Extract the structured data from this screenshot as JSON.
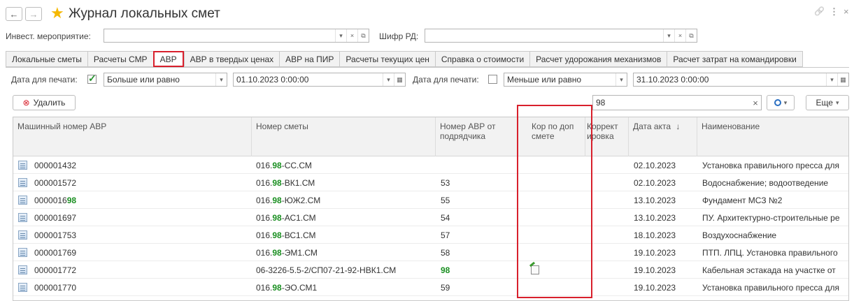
{
  "window": {
    "title": "Журнал локальных смет",
    "back_glyph": "←",
    "forward_glyph": "→",
    "star_glyph": "★",
    "link_glyph": "🔗",
    "more_glyph": "⋮",
    "close_glyph": "×"
  },
  "filters": {
    "invest_label": "Инвест. мероприятие:",
    "invest_value": "",
    "rd_label": "Шифр РД:",
    "rd_value": "",
    "dropdown_glyph": "▾",
    "clear_glyph": "×",
    "open_glyph": "⧉"
  },
  "tabs": [
    {
      "label": "Локальные сметы",
      "active": false
    },
    {
      "label": "Расчеты СМР",
      "active": false
    },
    {
      "label": "АВР",
      "active": true
    },
    {
      "label": "АВР в твердых ценах",
      "active": false
    },
    {
      "label": "АВР на ПИР",
      "active": false
    },
    {
      "label": "Расчеты текущих цен",
      "active": false
    },
    {
      "label": "Справка о стоимости",
      "active": false
    },
    {
      "label": "Расчет удорожания механизмов",
      "active": false
    },
    {
      "label": "Расчет затрат на командировки",
      "active": false
    }
  ],
  "date_filter": {
    "from_label": "Дата для печати:",
    "from_checked": true,
    "from_condition": "Больше или равно",
    "from_date": "01.10.2023  0:00:00",
    "to_label": "Дата для печати:",
    "to_checked": false,
    "to_condition": "Меньше или равно",
    "to_date": "31.10.2023  0:00:00",
    "calendar_glyph": "▦"
  },
  "toolbar": {
    "delete_icon": "⊗",
    "delete_label": "Удалить",
    "search_value": "98",
    "search_clear": "×",
    "search_icon": "🔍",
    "more_label": "Еще"
  },
  "table": {
    "columns": {
      "machine_number": "Машинный номер АВР",
      "estimate_number": "Номер сметы",
      "contractor_number": "Номер АВР от подрядчика",
      "kor_dop": "Кор по доп смете",
      "correction": "Коррект ировка",
      "act_date": "Дата акта",
      "sort_glyph": "↓",
      "name": "Наименование"
    },
    "rows": [
      {
        "machine_a": "000001432",
        "machine_hl": "",
        "est_a": "016.",
        "est_hl": "98",
        "est_b": "-СС.СМ",
        "contractor": "",
        "contractor_hl": false,
        "kor": false,
        "date": "02.10.2023",
        "name": "Установка правильного пресса для"
      },
      {
        "machine_a": "000001572",
        "machine_hl": "",
        "est_a": "016.",
        "est_hl": "98",
        "est_b": "-ВК1.СМ",
        "contractor": "53",
        "contractor_hl": false,
        "kor": false,
        "date": "02.10.2023",
        "name": "Водоснабжение; водоотведение"
      },
      {
        "machine_a": "0000016",
        "machine_hl": "98",
        "est_a": "016.",
        "est_hl": "98",
        "est_b": "-ЮЖ2.СМ",
        "contractor": "55",
        "contractor_hl": false,
        "kor": false,
        "date": "13.10.2023",
        "name": "Фундамент МСЗ №2"
      },
      {
        "machine_a": "000001697",
        "machine_hl": "",
        "est_a": "016.",
        "est_hl": "98",
        "est_b": "-АС1.СМ",
        "contractor": "54",
        "contractor_hl": false,
        "kor": false,
        "date": "13.10.2023",
        "name": "ПУ. Архитектурно-строительные ре"
      },
      {
        "machine_a": "000001753",
        "machine_hl": "",
        "est_a": "016.",
        "est_hl": "98",
        "est_b": "-ВС1.СМ",
        "contractor": "57",
        "contractor_hl": false,
        "kor": false,
        "date": "18.10.2023",
        "name": "Воздухоснабжение"
      },
      {
        "machine_a": "000001769",
        "machine_hl": "",
        "est_a": "016.",
        "est_hl": "98",
        "est_b": "-ЭМ1.СМ",
        "contractor": "58",
        "contractor_hl": false,
        "kor": false,
        "date": "19.10.2023",
        "name": " ПТП. ЛПЦ. Установка правильного"
      },
      {
        "machine_a": "000001772",
        "machine_hl": "",
        "est_a": "06-3226-5.5-2/СП07-21-92-НВК1.СМ",
        "est_hl": "",
        "est_b": "",
        "contractor": "98",
        "contractor_hl": true,
        "kor": true,
        "date": "19.10.2023",
        "name": "Кабельная эстакада на участке от"
      },
      {
        "machine_a": "000001770",
        "machine_hl": "",
        "est_a": "016.",
        "est_hl": "98",
        "est_b": "-ЭО.СМ1",
        "contractor": "59",
        "contractor_hl": false,
        "kor": false,
        "date": "19.10.2023",
        "name": "Установка правильного пресса для"
      }
    ]
  }
}
